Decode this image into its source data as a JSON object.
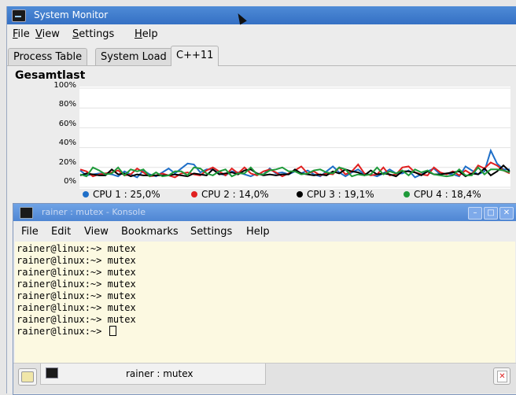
{
  "sysmon": {
    "title": "System Monitor",
    "menu": [
      {
        "underlined": "F",
        "rest": "ile"
      },
      {
        "underlined": "V",
        "rest": "iew"
      },
      {
        "underlined": "S",
        "rest": "ettings"
      },
      {
        "underlined": "H",
        "rest": "elp"
      }
    ],
    "tabs": [
      "Process Table",
      "System Load",
      "C++11"
    ],
    "active_tab": "C++11"
  },
  "chart_data": {
    "type": "line",
    "title": "Gesamtlast",
    "ylim": [
      0,
      100
    ],
    "yticks": [
      "100%",
      "80%",
      "60%",
      "40%",
      "20%",
      "0%"
    ],
    "grid": true,
    "legend_placement": "bottom",
    "series": [
      {
        "name": "CPU 1 : 25,0%",
        "color": "#1f6fc8",
        "values": [
          17,
          12,
          13,
          14,
          14,
          13,
          11,
          16,
          13,
          10,
          17,
          13,
          11,
          15,
          19,
          14,
          19,
          24,
          23,
          15,
          18,
          18,
          14,
          12,
          16,
          15,
          13,
          11,
          14,
          13,
          19,
          14,
          15,
          13,
          16,
          14,
          17,
          13,
          11,
          16,
          21,
          15,
          11,
          15,
          18,
          13,
          13,
          11,
          14,
          18,
          14,
          14,
          17,
          10,
          13,
          16,
          19,
          13,
          14,
          13,
          11,
          21,
          17,
          13,
          16,
          37,
          24,
          18,
          18
        ]
      },
      {
        "name": "CPU 2 : 14,0%",
        "color": "#e02020",
        "values": [
          18,
          16,
          11,
          13,
          14,
          15,
          17,
          12,
          13,
          19,
          15,
          11,
          12,
          14,
          12,
          10,
          14,
          15,
          13,
          12,
          17,
          20,
          16,
          12,
          19,
          14,
          20,
          14,
          12,
          16,
          18,
          15,
          11,
          14,
          17,
          21,
          14,
          16,
          12,
          14,
          13,
          20,
          13,
          16,
          23,
          14,
          12,
          13,
          20,
          12,
          13,
          20,
          21,
          15,
          13,
          12,
          20,
          15,
          13,
          16,
          12,
          17,
          13,
          22,
          19,
          25,
          22,
          17,
          14
        ]
      },
      {
        "name": "CPU 3 : 19,1%",
        "color": "#000000",
        "values": [
          12,
          14,
          13,
          12,
          12,
          18,
          13,
          14,
          11,
          13,
          12,
          12,
          12,
          12,
          12,
          13,
          12,
          11,
          14,
          13,
          12,
          18,
          13,
          14,
          15,
          13,
          17,
          18,
          14,
          12,
          13,
          12,
          13,
          13,
          18,
          14,
          13,
          12,
          13,
          12,
          16,
          14,
          18,
          16,
          15,
          12,
          17,
          13,
          14,
          13,
          11,
          16,
          16,
          15,
          12,
          16,
          13,
          13,
          14,
          15,
          16,
          11,
          14,
          13,
          19,
          12,
          16,
          22,
          16
        ]
      },
      {
        "name": "CPU 4 : 18,4%",
        "color": "#1f9a3a",
        "values": [
          13,
          11,
          20,
          17,
          13,
          14,
          20,
          12,
          18,
          16,
          18,
          11,
          15,
          11,
          12,
          16,
          16,
          12,
          20,
          19,
          14,
          12,
          16,
          18,
          11,
          14,
          14,
          20,
          13,
          13,
          17,
          18,
          20,
          16,
          16,
          13,
          14,
          17,
          18,
          15,
          14,
          20,
          18,
          11,
          13,
          12,
          13,
          20,
          13,
          16,
          14,
          17,
          12,
          18,
          15,
          17,
          13,
          12,
          11,
          12,
          18,
          12,
          12,
          20,
          13,
          18,
          18,
          17,
          15
        ]
      }
    ]
  },
  "konsole": {
    "title": "rainer : mutex - Konsole",
    "buttons": {
      "minimize": "–",
      "maximize": "□",
      "close": "✕"
    },
    "menu": [
      "File",
      "Edit",
      "View",
      "Bookmarks",
      "Settings",
      "Help"
    ],
    "lines": [
      "rainer@linux:~> mutex",
      "rainer@linux:~> mutex",
      "rainer@linux:~> mutex",
      "rainer@linux:~> mutex",
      "rainer@linux:~> mutex",
      "rainer@linux:~> mutex",
      "rainer@linux:~> mutex"
    ],
    "prompt": "rainer@linux:~> ",
    "session_tab_label": "rainer : mutex"
  },
  "colors": {
    "titlebar": "#3f7ccb",
    "terminal_bg": "#fcf9e1",
    "window_bg": "#ececec"
  }
}
